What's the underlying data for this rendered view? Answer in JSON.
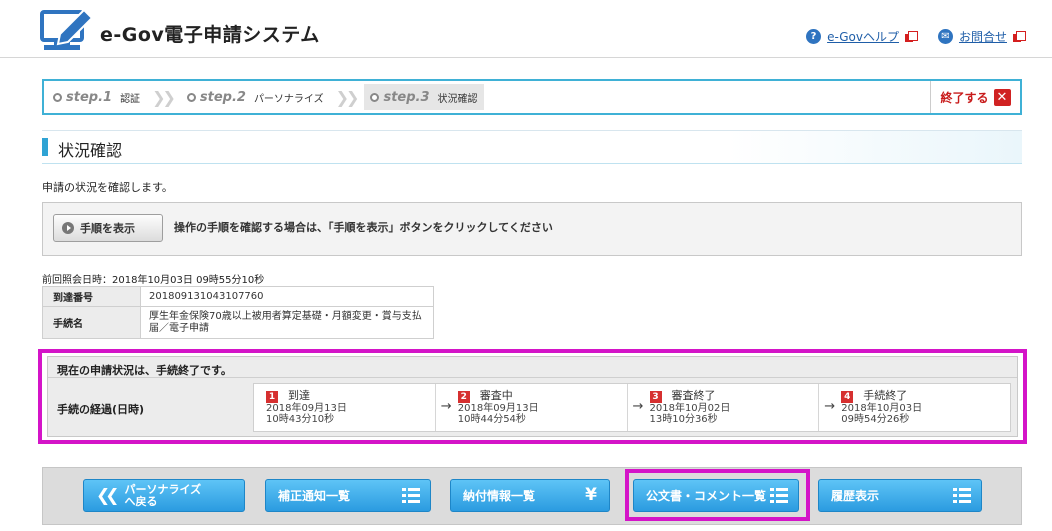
{
  "header": {
    "site_title": "e-Gov電子申請システム",
    "help_link": "e-Govヘルプ",
    "contact_link": "お問合せ"
  },
  "steps": [
    {
      "num": "step.1",
      "label": "認証"
    },
    {
      "num": "step.2",
      "label": "パーソナライズ"
    },
    {
      "num": "step.3",
      "label": "状況確認"
    }
  ],
  "end_button": "終了する",
  "page_title": "状況確認",
  "description": "申請の状況を確認します。",
  "procedure": {
    "button": "手順を表示",
    "text": "操作の手順を確認する場合は、「手順を表示」ボタンをクリックしてください"
  },
  "last_reference": "前回照会日時：2018年10月03日 09時55分10秒",
  "info": {
    "arrival_label": "到達番号",
    "arrival_value": "201809131043107760",
    "procedure_label": "手続名",
    "procedure_value": "厚生年金保険70歳以上被用者算定基礎・月額変更・賞与支払届／電子申請"
  },
  "status": {
    "heading": "現在の申請状況は、手続終了です。",
    "progress_label": "手続の経過(日時)",
    "timeline": [
      {
        "num": "1",
        "name": "到達",
        "date": "2018年09月13日",
        "time": "10時43分10秒"
      },
      {
        "num": "2",
        "name": "審査中",
        "date": "2018年09月13日",
        "time": "10時44分54秒"
      },
      {
        "num": "3",
        "name": "審査終了",
        "date": "2018年10月02日",
        "time": "13時10分36秒"
      },
      {
        "num": "4",
        "name": "手続終了",
        "date": "2018年10月03日",
        "time": "09時54分26秒"
      }
    ]
  },
  "bottom": {
    "back_line1": "パーソナライズ",
    "back_line2": "へ戻る",
    "correction": "補正通知一覧",
    "payment": "納付情報一覧",
    "documents": "公文書・コメント一覧",
    "history": "履歴表示"
  },
  "colors": {
    "accent": "#2fa3d4",
    "highlight": "#d414c8",
    "button": "#3aa9ea",
    "alert": "#d02222"
  }
}
